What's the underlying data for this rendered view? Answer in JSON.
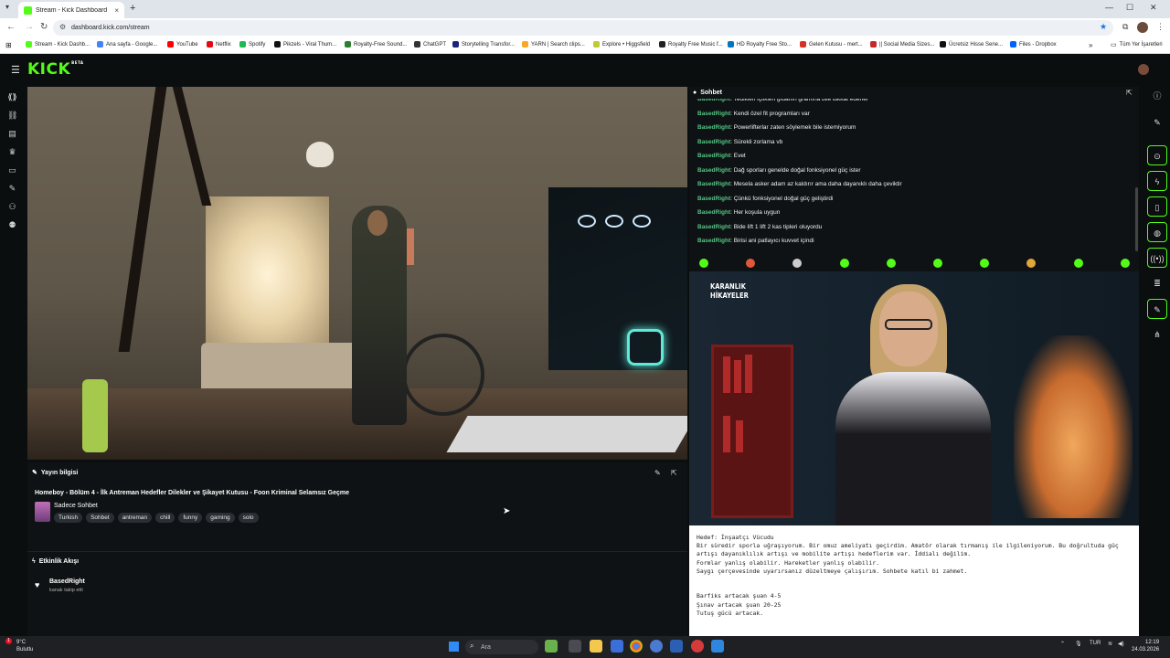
{
  "browser": {
    "tab_title": "Stream - Kick Dashboard",
    "tab_close": "×",
    "new_tab": "+",
    "url": "dashboard.kick.com/stream",
    "bookmarks": [
      {
        "label": "Stream - Kick Dashb...",
        "color": "#53fc18"
      },
      {
        "label": "Ana sayfa - Google...",
        "color": "#4285f4"
      },
      {
        "label": "YouTube",
        "color": "#ff0000"
      },
      {
        "label": "Netflix",
        "color": "#e50914"
      },
      {
        "label": "Spotify",
        "color": "#1db954"
      },
      {
        "label": "Pikzels - Viral Thum...",
        "color": "#111111"
      },
      {
        "label": "Royalty-Free Sound...",
        "color": "#2e7d32"
      },
      {
        "label": "ChatGPT",
        "color": "#333333"
      },
      {
        "label": "Storytelling Transfor...",
        "color": "#1a237e"
      },
      {
        "label": "YARN | Search clips...",
        "color": "#f9a825"
      },
      {
        "label": "Explore • Higgsfield",
        "color": "#c0ca33"
      },
      {
        "label": "Royalty Free Music f...",
        "color": "#222222"
      },
      {
        "label": "HD Royalty Free Sto...",
        "color": "#0277bd"
      },
      {
        "label": "Gelen Kutusu - mert...",
        "color": "#d93025"
      },
      {
        "label": "|| Social Media Sizes...",
        "color": "#c62828"
      },
      {
        "label": "Ücretsiz Hisse Sene...",
        "color": "#111111"
      },
      {
        "label": "Files - Dropbox",
        "color": "#0061fe"
      }
    ],
    "bookmarks_more": "»",
    "all_bookmarks": "Tüm Yer İşaretleri"
  },
  "app": {
    "logo": "KICK",
    "logo_beta": "BETA",
    "accent": "#53fc18"
  },
  "stream_info": {
    "header": "Yayın bilgisi",
    "title": "Homeboy - Bölüm 4 - İlk Antreman Hedefler Dilekler ve Şikayet Kutusu - Foon Kriminal Selamsız Geçme",
    "category": "Sadece Sohbet",
    "tags": [
      "Turkish",
      "Sohbet",
      "antreman",
      "chill",
      "funny",
      "gaming",
      "solo"
    ]
  },
  "activity": {
    "header": "Etkinlik Akışı",
    "items": [
      {
        "user": "BasedRight",
        "text": "kanalı takip etti"
      }
    ]
  },
  "chat": {
    "header": "Sohbet",
    "user_color": "#53c785",
    "messages": [
      {
        "user": "BasedRight",
        "text": ": Tedikleri içtikleri gıdanın gramına bile dikkat ederler"
      },
      {
        "user": "BasedRight",
        "text": ": Kendi özel fit programları var"
      },
      {
        "user": "BasedRight",
        "text": ": Powerlifterlar zaten söylemek bile istemiyorum"
      },
      {
        "user": "BasedRight",
        "text": ": Sürekli zorlama vb"
      },
      {
        "user": "BasedRight",
        "text": ": Evet"
      },
      {
        "user": "BasedRight",
        "text": ": Dağ sporları genelde doğal fonksiyonel güç ister"
      },
      {
        "user": "BasedRight",
        "text": ": Mesela asker adam az kaldırır ama daha dayanıklı daha çeviktir"
      },
      {
        "user": "BasedRight",
        "text": ": Çünkü fonksiyonel doğal güç geliştirdi"
      },
      {
        "user": "BasedRight",
        "text": ": Her koşula uygun"
      },
      {
        "user": "BasedRight",
        "text": ": Bide lift 1 lift 2 kas tipleri oluyordu"
      },
      {
        "user": "BasedRight",
        "text": ": Birisi ani patlayıcı kuvvet içindi"
      }
    ]
  },
  "overlay": {
    "title_line1": "KARANLIK",
    "title_line2": "HİKAYELER"
  },
  "notes": {
    "lines": [
      "Hedef: İnşaatçı Vücudu",
      "Bir süredir sporla uğraşıyorum. Bir omuz ameliyatı geçirdim. Amatör olarak tırmanış ile ilgileniyorum. Bu doğrultuda güç",
      "artışı dayanıklılık artışı ve mobilite artışı hedeflerim var. İddialı değilim.",
      "Formlar yanlış olabilir. Hareketler yanlış olabilir.",
      "Saygı çerçevesinde uyarırsanız düzeltmeye çalışırım. Sohbete katıl bi zahmet.",
      "",
      "",
      "Barfiks artacak şuan 4-5",
      "Şınav artacak  şuan 20-25",
      "Tutuş gücü artacak."
    ]
  },
  "taskbar": {
    "weather_temp": "9°C",
    "weather_desc": "Bulutlu",
    "weather_badge": "1",
    "search_placeholder": "Ara",
    "lang": "TUR",
    "time": "12:19",
    "date": "24.03.2026"
  }
}
